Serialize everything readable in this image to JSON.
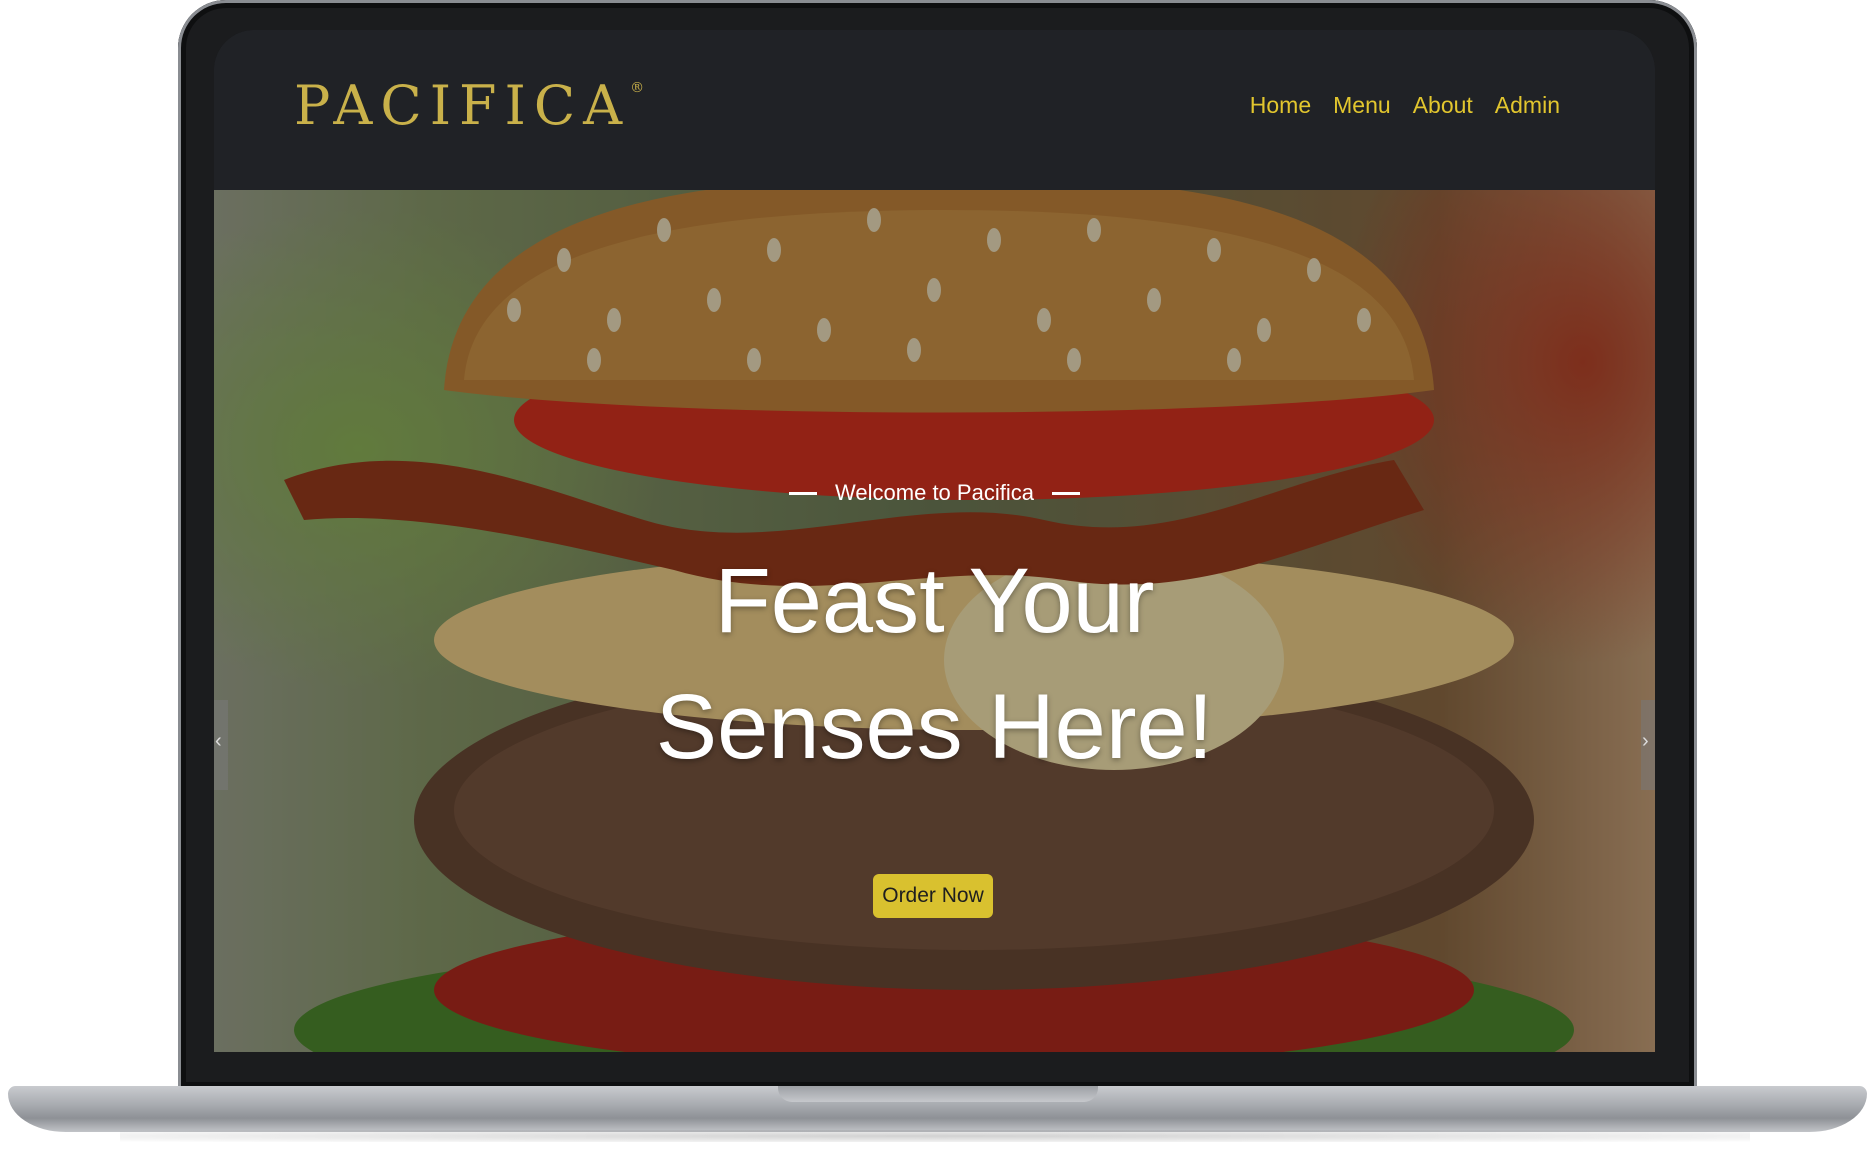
{
  "brand": {
    "logo_text": "PACIFICA",
    "logo_mark": "®",
    "accent_color": "#e2c62e",
    "logo_color": "#c9b14a",
    "header_bg": "#202226"
  },
  "nav": {
    "items": [
      {
        "label": "Home"
      },
      {
        "label": "Menu"
      },
      {
        "label": "About"
      },
      {
        "label": "Admin"
      }
    ]
  },
  "hero": {
    "tagline": "Welcome to Pacifica",
    "headline_line1": "Feast Your",
    "headline_line2": "Senses Here!",
    "cta_label": "Order Now",
    "cta_color": "#d9c12f",
    "prev_icon": "chevron-left-icon",
    "next_icon": "chevron-right-icon"
  }
}
